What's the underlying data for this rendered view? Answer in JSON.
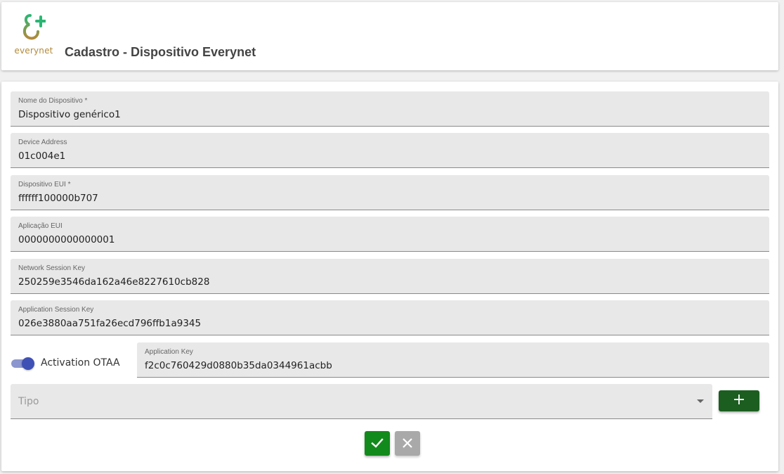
{
  "header": {
    "logo_text": "everynet",
    "title": "Cadastro - Dispositivo Everynet"
  },
  "form": {
    "fields": [
      {
        "label": "Nome do Dispositivo *",
        "value": "Dispositivo genérico1"
      },
      {
        "label": "Device Address",
        "value": "01c004e1"
      },
      {
        "label": "Dispositivo EUI *",
        "value": "ffffff100000b707"
      },
      {
        "label": "Aplicação EUI",
        "value": "0000000000000001"
      },
      {
        "label": "Network Session Key",
        "value": "250259e3546da162a46e8227610cb828"
      },
      {
        "label": "Application Session Key",
        "value": "026e3880aa751fa26ecd796ffb1a9345"
      },
      {
        "label": "Application Key",
        "value": "f2c0c760429d0880b35da0344961acbb"
      }
    ],
    "activation_toggle": {
      "label": "Activation OTAA",
      "checked": true
    },
    "tipo_select": {
      "placeholder": "Tipo",
      "value": ""
    },
    "add_button": {
      "icon": "plus-icon",
      "symbol": "+"
    },
    "confirm_button": {
      "icon": "check-icon"
    },
    "cancel_button": {
      "icon": "close-icon"
    }
  },
  "colors": {
    "primary_green": "#1b5e20",
    "confirm_green": "#138a1c",
    "toggle_blue": "#3f51b5",
    "logo_green": "#2bb673",
    "logo_gold": "#b38a3a"
  }
}
